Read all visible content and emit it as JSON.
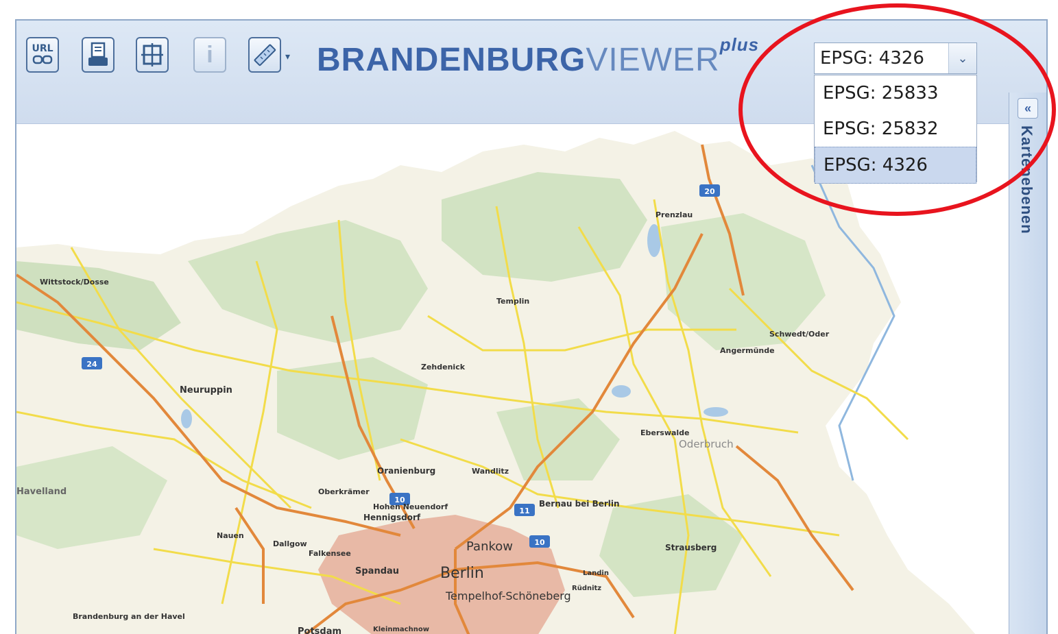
{
  "toolbar": {
    "buttons": [
      {
        "icon": "url-link-icon",
        "label": "URL"
      },
      {
        "icon": "print-icon"
      },
      {
        "icon": "grid-icon"
      },
      {
        "icon": "info-icon",
        "label": "i"
      },
      {
        "icon": "measure-icon"
      }
    ],
    "brand_bold": "BRANDENBURG",
    "brand_light": "VIEWER",
    "brand_sup": "plus"
  },
  "crs_select": {
    "value": "EPSG: 4326",
    "options": [
      "EPSG: 25833",
      "EPSG: 25832",
      "EPSG: 4326"
    ],
    "selected_index": 2
  },
  "side_panel": {
    "collapse_glyph": "«",
    "label": "Kartenebenen"
  },
  "map": {
    "places": [
      "Wittstock/Dosse",
      "Prenzlau",
      "Templin",
      "Schwedt/Oder",
      "Angermünde",
      "Zehdenick",
      "Neuruppin",
      "Eberswalde",
      "Oderbruch",
      "Oranienburg",
      "Wandlitz",
      "Havelland",
      "Oberkrämer",
      "Hohen Neuendorf",
      "Hennigsdorf",
      "Bernau bei Berlin",
      "Pankow",
      "Nauen",
      "Dallgow",
      "Falkensee",
      "Spandau",
      "Berlin",
      "Strausberg",
      "Tempelhof-Schöneberg",
      "Brandenburg an der Havel",
      "Potsdam",
      "Kleinmachnow",
      "Landin",
      "Rüdnitz"
    ],
    "road_shields": [
      "20",
      "24",
      "10",
      "11",
      "10"
    ]
  }
}
